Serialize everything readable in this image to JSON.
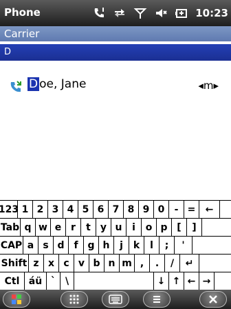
{
  "titlebar": {
    "app": "Phone",
    "time": "10:23"
  },
  "carrier": {
    "label": "Carrier"
  },
  "group": {
    "letter": "D"
  },
  "contact": {
    "first_letter": "D",
    "rest": "oe, Jane",
    "tag": "◂m▸"
  },
  "keyboard": {
    "rows": [
      [
        "123",
        "1",
        "2",
        "3",
        "4",
        "5",
        "6",
        "7",
        "8",
        "9",
        "0",
        "-",
        "=",
        "←"
      ],
      [
        "Tab",
        "q",
        "w",
        "e",
        "r",
        "t",
        "y",
        "u",
        "i",
        "o",
        "p",
        "[",
        "]"
      ],
      [
        "CAP",
        "a",
        "s",
        "d",
        "f",
        "g",
        "h",
        "j",
        "k",
        "l",
        ";",
        "'"
      ],
      [
        "Shift",
        "z",
        "x",
        "c",
        "v",
        "b",
        "n",
        "m",
        ",",
        ".",
        "/",
        "↵"
      ],
      [
        "Ctl",
        "áü",
        "`",
        "\\",
        " ",
        "↓",
        "↑",
        "←",
        "→"
      ]
    ]
  },
  "softkeys": [
    "start-icon",
    "dialpad-icon",
    "keyboard-icon",
    "menu-icon",
    "close-icon"
  ]
}
